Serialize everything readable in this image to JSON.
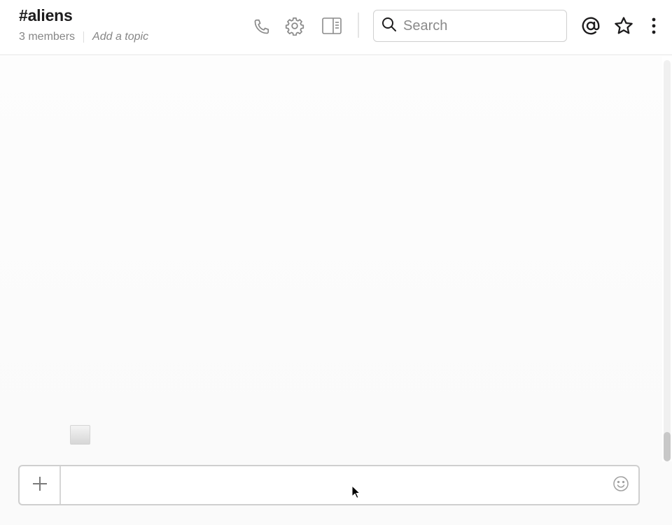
{
  "channel": {
    "title": "#aliens",
    "members": "3 members",
    "topic_placeholder": "Add a topic"
  },
  "header": {
    "icons": [
      "phone-icon",
      "gear-icon",
      "details-panel-icon",
      "at-mentions-icon",
      "star-icon",
      "more-icon"
    ]
  },
  "search": {
    "placeholder": "Search",
    "value": ""
  },
  "composer": {
    "placeholder": "",
    "value": "",
    "icons": [
      "plus-icon",
      "emoji-icon"
    ]
  },
  "colors": {
    "border": "#cfcfcf",
    "muted_text": "#868686",
    "icon_gray": "#8a8a8a",
    "icon_dark": "#1d1c1d"
  }
}
